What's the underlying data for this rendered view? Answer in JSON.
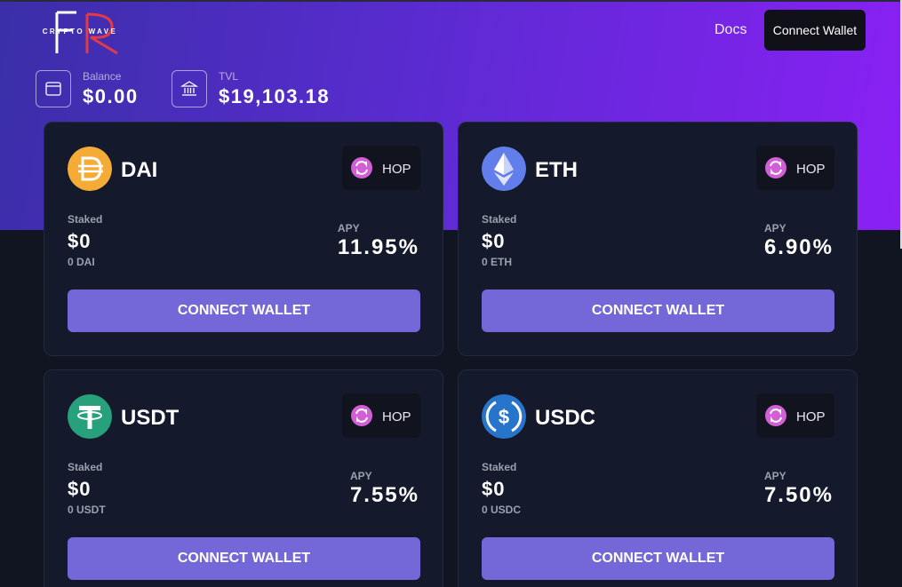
{
  "logo": {
    "monogram": "FR",
    "text": "CRYPTO WAVE"
  },
  "nav": {
    "docs_label": "Docs",
    "connect_label": "Connect Wallet"
  },
  "stats": {
    "balance": {
      "icon": "wallet-icon",
      "label": "Balance",
      "value": "$0.00"
    },
    "tvl": {
      "icon": "bank-icon",
      "label": "TVL",
      "value": "$19,103.18"
    }
  },
  "cards": [
    {
      "token": "DAI",
      "token_icon": "dai-icon",
      "color": "#F5AC37",
      "hop_label": "HOP",
      "staked_label": "Staked",
      "staked_value": "$0",
      "staked_sub": "0 DAI",
      "apy_label": "APY",
      "apy_value": "11.95%",
      "button_label": "CONNECT WALLET"
    },
    {
      "token": "ETH",
      "token_icon": "eth-icon",
      "color": "#627EEA",
      "hop_label": "HOP",
      "staked_label": "Staked",
      "staked_value": "$0",
      "staked_sub": "0 ETH",
      "apy_label": "APY",
      "apy_value": "6.90%",
      "button_label": "CONNECT WALLET"
    },
    {
      "token": "USDT",
      "token_icon": "usdt-icon",
      "color": "#26A17B",
      "hop_label": "HOP",
      "staked_label": "Staked",
      "staked_value": "$0",
      "staked_sub": "0 USDT",
      "apy_label": "APY",
      "apy_value": "7.55%",
      "button_label": "CONNECT WALLET"
    },
    {
      "token": "USDC",
      "token_icon": "usdc-icon",
      "color": "#2775CA",
      "hop_label": "HOP",
      "staked_label": "Staked",
      "staked_value": "$0",
      "staked_sub": "0 USDC",
      "apy_label": "APY",
      "apy_value": "7.50%",
      "button_label": "CONNECT WALLET"
    }
  ],
  "colors": {
    "accent": "#7467D8",
    "hero_start": "#3A2FA8",
    "hero_end": "#8A20F5",
    "background": "#111521",
    "card": "#141A2B"
  }
}
